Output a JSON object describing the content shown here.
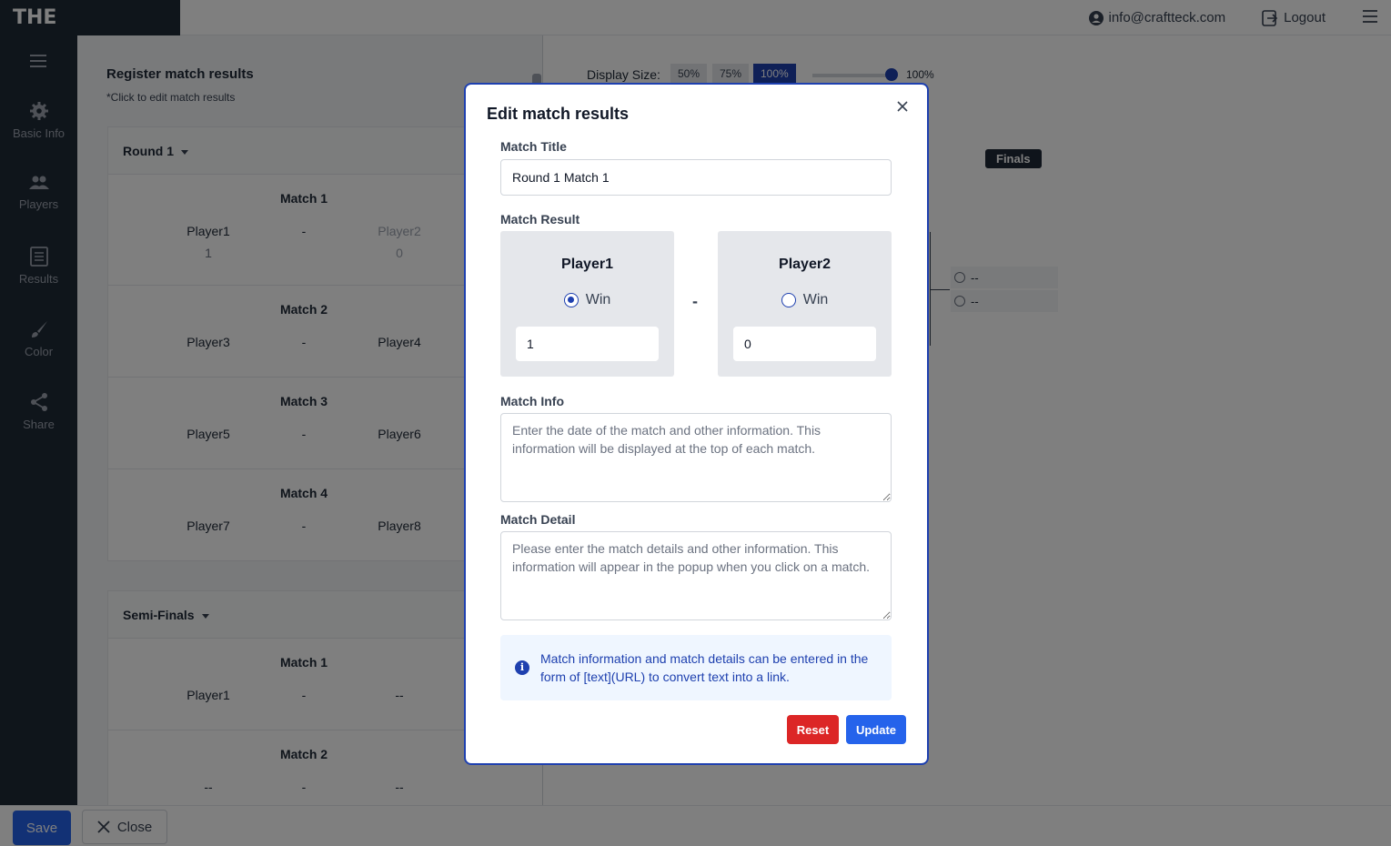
{
  "app": {
    "title": "THE TOURNAMENT"
  },
  "topbar": {
    "email": "info@craftteck.com",
    "logout_label": "Logout"
  },
  "sidebar": {
    "items": [
      {
        "label": "Basic Info",
        "icon": "gear-icon"
      },
      {
        "label": "Players",
        "icon": "users-icon"
      },
      {
        "label": "Results",
        "icon": "list-icon"
      },
      {
        "label": "Color",
        "icon": "brush-icon"
      },
      {
        "label": "Share",
        "icon": "share-icon"
      }
    ]
  },
  "results_panel": {
    "title": "Register match results",
    "subtitle": "*Click to edit match results",
    "rounds": [
      {
        "name": "Round 1",
        "matches": [
          {
            "title": "Match 1",
            "player1": "Player1",
            "player2": "Player2",
            "separator": "-",
            "score1": "1",
            "score2": "0"
          },
          {
            "title": "Match 2",
            "player1": "Player3",
            "player2": "Player4",
            "separator": "-"
          },
          {
            "title": "Match 3",
            "player1": "Player5",
            "player2": "Player6",
            "separator": "-"
          },
          {
            "title": "Match 4",
            "player1": "Player7",
            "player2": "Player8",
            "separator": "-"
          }
        ]
      },
      {
        "name": "Semi-Finals",
        "matches": [
          {
            "title": "Match 1",
            "player1": "Player1",
            "player2": "--",
            "separator": "-"
          },
          {
            "title": "Match 2",
            "player1": "--",
            "player2": "--",
            "separator": "-"
          }
        ]
      }
    ]
  },
  "display_size": {
    "label": "Display Size:",
    "options": [
      "50%",
      "75%",
      "100%"
    ],
    "selected": "100%",
    "value_label": "100%",
    "level": 1.0
  },
  "bracket": {
    "finals_label": "Finals",
    "final_slots": [
      "--",
      "--"
    ]
  },
  "modal": {
    "title": "Edit match results",
    "match_title_label": "Match Title",
    "match_title_value": "Round 1 Match 1",
    "match_result_label": "Match Result",
    "separator": "-",
    "player1": {
      "name": "Player1",
      "win_label": "Win",
      "score": "1",
      "win_selected": true
    },
    "player2": {
      "name": "Player2",
      "win_label": "Win",
      "score": "0",
      "win_selected": false
    },
    "match_info_label": "Match Info",
    "match_info_placeholder": "Enter the date of the match and other information. This information will be displayed at the top of each match.",
    "match_detail_label": "Match Detail",
    "match_detail_placeholder": "Please enter the match details and other information. This information will appear in the popup when you click on a match.",
    "note": "Match information and match details can be entered in the form of [text](URL) to convert text into a link.",
    "reset_label": "Reset",
    "update_label": "Update"
  },
  "bottombar": {
    "save_label": "Save",
    "close_label": "Close"
  },
  "colors": {
    "accent": "#2563eb",
    "danger": "#dc2626",
    "sidebar": "#1f2a37",
    "modal_border": "#1e40af"
  }
}
